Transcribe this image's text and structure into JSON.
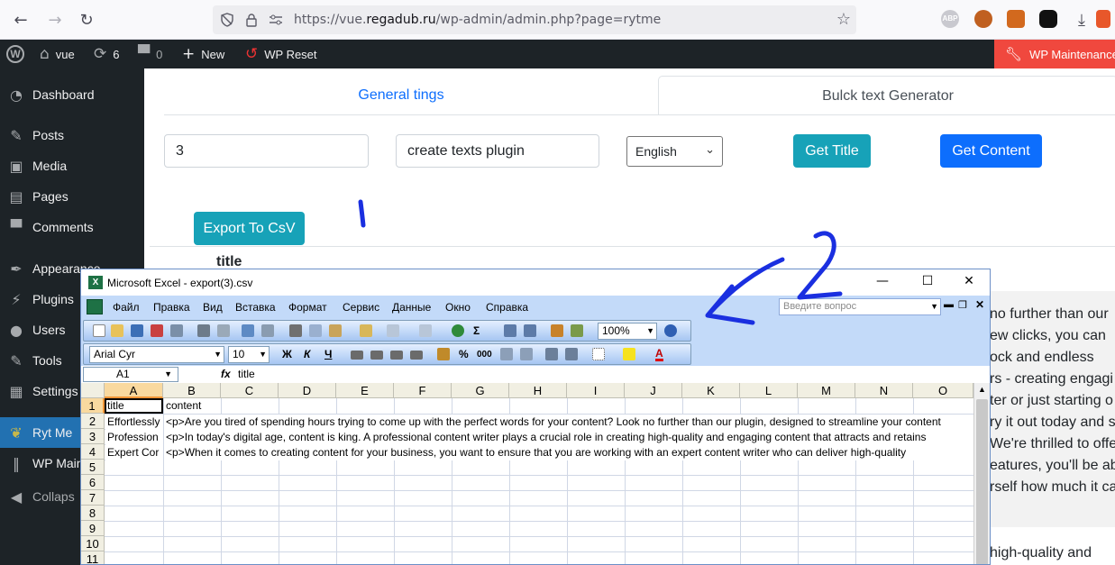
{
  "browser": {
    "url_prefix": "https://vue.",
    "url_domain": "regadub.ru",
    "url_path": "/wp-admin/admin.php?page=rytme",
    "ext_abp": "ABP"
  },
  "adminbar": {
    "site": "vue",
    "updates": "6",
    "comments": "0",
    "new": "New",
    "wp_reset": "WP Reset",
    "maintenance": "WP Maintenance"
  },
  "sidebar": {
    "items": [
      {
        "label": "Dashboard",
        "icon": "gauge-icon"
      },
      {
        "label": "Posts",
        "icon": "pin-icon"
      },
      {
        "label": "Media",
        "icon": "media-icon"
      },
      {
        "label": "Pages",
        "icon": "pages-icon"
      },
      {
        "label": "Comments",
        "icon": "comment-icon"
      },
      {
        "label": "Appearance",
        "icon": "brush-icon"
      },
      {
        "label": "Plugins",
        "icon": "plug-icon"
      },
      {
        "label": "Users",
        "icon": "users-icon"
      },
      {
        "label": "Tools",
        "icon": "wrench-icon"
      },
      {
        "label": "Settings",
        "icon": "sliders-icon"
      },
      {
        "label": "Ryt Me",
        "icon": "leaf-icon"
      },
      {
        "label": "WP Main",
        "icon": "tools-icon"
      },
      {
        "label": "Collaps",
        "icon": "collapse-icon"
      }
    ]
  },
  "plugin": {
    "tab_general": "General tings",
    "tab_bulk": "Bulck text Generator",
    "count_value": "3",
    "topic_value": "create texts plugin",
    "language": "English",
    "get_title": "Get Title",
    "get_content": "Get Content",
    "export_csv": "Export To CsV",
    "bg_header": "title",
    "bg_lines": [
      "no further than our",
      "ew clicks, you can",
      "ock and endless",
      "rs - creating engagi",
      "ter or just starting o",
      "ry it out today and s",
      "We're thrilled to offer",
      "eatures, you'll be ab",
      "rself how much it ca",
      "high-quality and"
    ]
  },
  "annotations": {
    "one": "1",
    "two": "2"
  },
  "excel": {
    "title": "Microsoft Excel - export(3).csv",
    "menu": [
      "Файл",
      "Правка",
      "Вид",
      "Вставка",
      "Формат",
      "Сервис",
      "Данные",
      "Окно",
      "Справка"
    ],
    "help_placeholder": "Введите вопрос",
    "zoom": "100%",
    "font": "Arial Cyr",
    "font_size": "10",
    "bold": "Ж",
    "italic": "К",
    "underline": "Ч",
    "name_box": "A1",
    "fx": "fx",
    "formula": "title",
    "columns": [
      "A",
      "B",
      "C",
      "D",
      "E",
      "F",
      "G",
      "H",
      "I",
      "J",
      "K",
      "L",
      "M",
      "N",
      "O"
    ],
    "rows": [
      "1",
      "2",
      "3",
      "4",
      "5",
      "6",
      "7",
      "8",
      "9",
      "10",
      "11"
    ],
    "cells": [
      {
        "a": "title",
        "b": "content"
      },
      {
        "a": "Effortlessly",
        "b": "<p>Are you tired of spending hours trying to come up with the perfect words for your content? Look no further than our plugin, designed to streamline your content"
      },
      {
        "a": "Profession",
        "b": "<p>In today's digital age, content is king. A professional content writer plays a crucial role in creating high-quality and engaging content that attracts and retains"
      },
      {
        "a": "Expert Cor",
        "b": "<p>When it comes to creating content for your business, you want to ensure that you are working with an expert content writer who can deliver high-quality"
      }
    ]
  }
}
